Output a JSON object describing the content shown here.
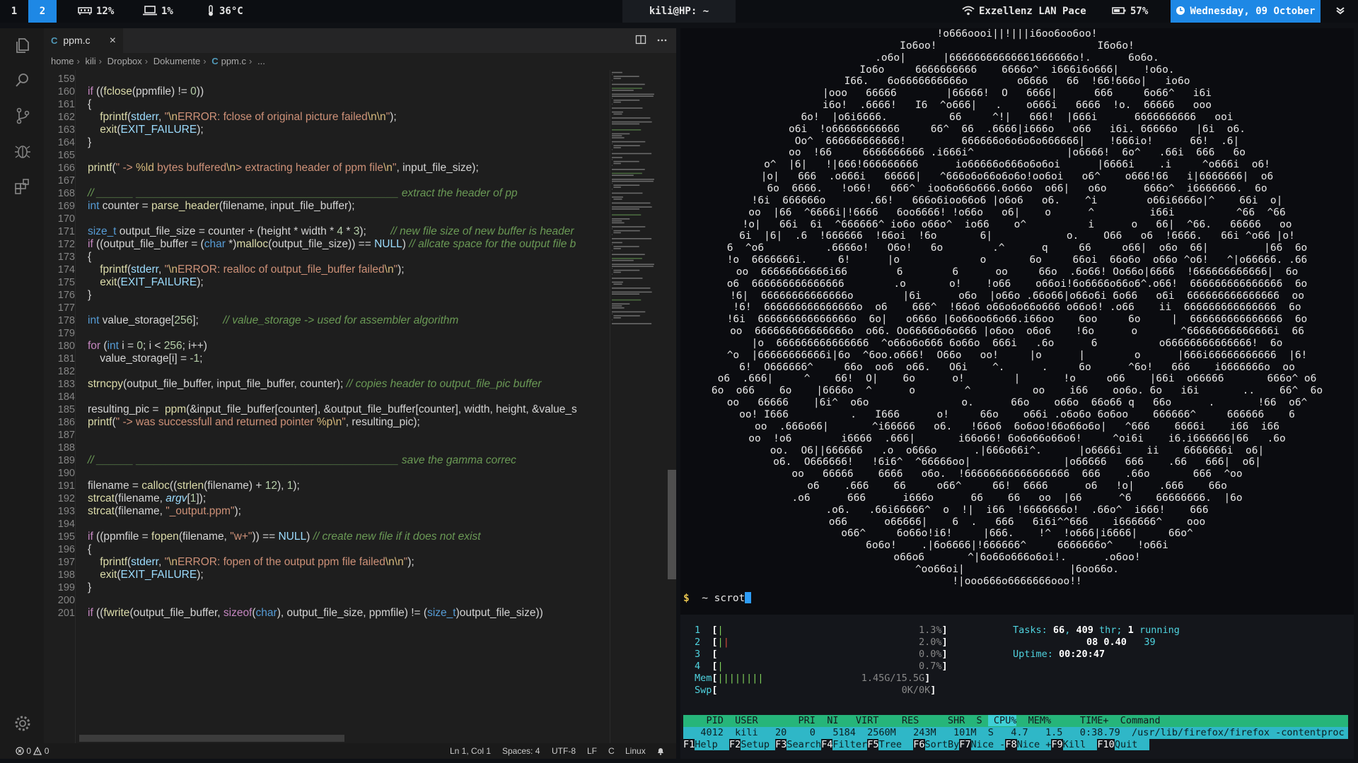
{
  "topbar": {
    "workspaces": [
      "1",
      "2"
    ],
    "ram": "12%",
    "cpu": "1%",
    "temp": "36°C",
    "window_title": "kili@HP: ~",
    "wifi": "Exzellenz LAN Pace",
    "battery": "57%",
    "date": "Wednesday, 09 October"
  },
  "editor": {
    "tab": {
      "icon": "C",
      "name": "ppm.c"
    },
    "breadcrumb": [
      "home",
      "kili",
      "Dropbox",
      "Dokumente",
      "ppm.c",
      "..."
    ],
    "breadcrumb_icon": "C",
    "lines": [
      {
        "n": "159",
        "t": ""
      },
      {
        "n": "160",
        "t": "if ((fclose(ppmfile) != 0))"
      },
      {
        "n": "161",
        "t": "{"
      },
      {
        "n": "162",
        "t": "    fprintf(stderr, \"\\nERROR: fclose of original picture failed\\n\\n\");"
      },
      {
        "n": "163",
        "t": "    exit(EXIT_FAILURE);"
      },
      {
        "n": "164",
        "t": "}"
      },
      {
        "n": "165",
        "t": ""
      },
      {
        "n": "166",
        "t": "printf(\" -> %ld bytes buffered\\n> extracting header of ppm file\\n\", input_file_size);"
      },
      {
        "n": "167",
        "t": ""
      },
      {
        "n": "168",
        "t": "// ______ ___________________________________________ extract the header of pp"
      },
      {
        "n": "169",
        "t": "int counter = parse_header(filename, input_file_buffer);"
      },
      {
        "n": "170",
        "t": ""
      },
      {
        "n": "171",
        "t": "size_t output_file_size = counter + (height * width * 4 * 3);        // new file size of new buffer is header"
      },
      {
        "n": "172",
        "t": "if ((output_file_buffer = (char *)malloc(output_file_size)) == NULL) // allcate space for the output file b"
      },
      {
        "n": "173",
        "t": "{"
      },
      {
        "n": "174",
        "t": "    fprintf(stderr, \"\\nERROR: realloc of output_file_buffer failed\\n\");"
      },
      {
        "n": "175",
        "t": "    exit(EXIT_FAILURE);"
      },
      {
        "n": "176",
        "t": "}"
      },
      {
        "n": "177",
        "t": ""
      },
      {
        "n": "178",
        "t": "int value_storage[256];        // value_storage -> used for assembler algorithm"
      },
      {
        "n": "179",
        "t": ""
      },
      {
        "n": "180",
        "t": "for (int i = 0; i < 256; i++)"
      },
      {
        "n": "181",
        "t": "    value_storage[i] = -1;"
      },
      {
        "n": "182",
        "t": ""
      },
      {
        "n": "183",
        "t": "strncpy(output_file_buffer, input_file_buffer, counter); // copies header to output_file_pic buffer"
      },
      {
        "n": "184",
        "t": ""
      },
      {
        "n": "185",
        "t": "resulting_pic =  ppm(&input_file_buffer[counter], &output_file_buffer[counter], width, height, &value_s"
      },
      {
        "n": "186",
        "t": "printf(\" -> was successfull and returned pointer %p\\n\", resulting_pic);"
      },
      {
        "n": "187",
        "t": ""
      },
      {
        "n": "188",
        "t": ""
      },
      {
        "n": "189",
        "t": "// ______ ___________________________________________ save the gamma correc"
      },
      {
        "n": "190",
        "t": ""
      },
      {
        "n": "191",
        "t": "filename = calloc((strlen(filename) + 12), 1);"
      },
      {
        "n": "192",
        "t": "strcat(filename, argv[1]);"
      },
      {
        "n": "193",
        "t": "strcat(filename, \"_output.ppm\");"
      },
      {
        "n": "194",
        "t": ""
      },
      {
        "n": "195",
        "t": "if ((ppmfile = fopen(filename, \"w+\")) == NULL) // create new file if it does not exist"
      },
      {
        "n": "196",
        "t": "{"
      },
      {
        "n": "197",
        "t": "    fprintf(stderr, \"\\nERROR: fopen of the output ppm file failed\\n\\n\");"
      },
      {
        "n": "198",
        "t": "    exit(EXIT_FAILURE);"
      },
      {
        "n": "199",
        "t": "}"
      },
      {
        "n": "200",
        "t": ""
      },
      {
        "n": "201",
        "t": "if ((fwrite(output_file_buffer, sizeof(char), output_file_size, ppmfile) != (size_t)output_file_size))"
      }
    ],
    "status": {
      "errors": "0",
      "warnings": "0",
      "position": "Ln 1, Col 1",
      "spaces": "Spaces: 4",
      "encoding": "UTF-8",
      "eol": "LF",
      "language": "C",
      "platform": "Linux"
    }
  },
  "terminal": {
    "ascii_art": "!o666oooi||!|||i6oo6oo6oo!\nIo6oo!                          I6o6o!\n.o6o|      |66666666666661666666o!.      6o6o.\nIo6o     6666666666    6666o^  i666i6o666|    !o6o.\nI66.   6o6666666666o        o6666   66  !66!666o|   io6o\n|ooo   66666        |66666!  O   6666|      666     6o66^   i6i\ni6o!  .6666!   I6  ^o666|   .    o666i   6666  !o.  66666   ooo\n6o!  |o6i6666.          66     ^!|   666!  |666i      6666666666   ooi\no6i  !o66666666666     66^  66  .6666|i666o   o66   i6i. 66666o   |6i  o6.\nOo^  666666666666!         666666o6o6o6o666666|    !666io!      66!  .6|\noo  !66     6666666666 .i666i^               |o6666!  6o^   .66i  666   6o\no^  |6|   !|666!666666666      io66666o666o6o6oi      |6666i    .i     ^o666i  o6!\n|o|   666  .o666i   66666|   ^666o6o66o6o6o!oo6oi   o6^    o666!66   i|6666666|  o6\n6o  6666.   !o66!   666^  ioo6o66o666.6o66o  o66|   o6o      666o^  i6666666.  6o\n!6i  666666o       .66!   666o6ioo66o6 |o6o6   o6.    ^i        o66i6666o|^    66i  o|\noo  |66  ^6666i|!6666   6oo6666! !o66o   o6|    o      ^         i66i          ^66  ^66\n!o|   66i  6i  ^666666^ io6o o66o^  io66    o^          i      o   66|  ^66.   66666   oo\n6i  |6|  .6  !666666  !66oi  !6o       6|            o.    O66   o6  !6666.   66i ^o66 |o!\n6  ^o6          .6666o!   O6o!   6o        .^      q     66     o66|  o6o  66|         |66  6o\n!o  6666666i.     6!      |o             o       6o     66oi  66o6o  o66o ^o6!   ^|o66666. .66\noo  66666666666i66        6        6      oo     66o  .6o66! Oo66o|6666  !666666666666|  6o\no6  666666666666666        .o       o!    !o66    o66oi!6o6666o66o6^.o66!  666666666666666  6o\n!6|  66666666666666o        |6i      o6o  |o66o .66o66|o66o6i 6o66   o6i  666666666666666  oo\n!6!  666666666666666o  o6    666^  !66o6 o66o6o66o666 o66o6! .o66    ii  666666666666666  6o\n!6i  666666666666666o  6o|   o666o |6o66oo66o66.i66oo    6oo     6o     |  666666666666666  6o\noo  666666666666666o  o66. Oo66666o6o666 |o6oo  o6o6    !6o      o       ^66666666666666i  66\n|o  666666666666666  ^o66o6o666 6o66o  666i   .6o      6          o66666666666666!  6o\n^o  |66666666666i|6o  ^6oo.o666!  O66o   oo!     |o      |        o      |666i66666666666  |6!\n6!  O666666^     66o  oo6  o66.   O6i    ^.      .     6o      ^6o!   666    i6666666o  oo\no6  .666|     ^    66!  O|    6o      o!        |       !o     o66    |66i  o66666       666o^ o6\n6o  o66    6o    |6666o  ^      o        ^          oo    i66    oo6o. 6o   i6i       ..    66^  6o\noo   66666    |6i^  o6o               o.      66o    o66o  66o66 q   66o      .       !66  o6^\noo! I666          .   I666      o!     66o    o66i .o6o6o 6o6oo    666666^     666666    6\noo  .666o66|       ^i66666   o6.   !66o6  6o6oo!66o66o6o|   ^666    6666i    i66  i66\noo  !o6        i6666  .666|       i66o66! 6o6o66o66o6!     ^oi6i    i6.i666666|66   .6o\noo.  O6||666666   .o  o666o      .|666o66i^.      |o6666i    ii    6666666i  o6|\no6.  O666666!   !6i6^  ^66666oo|               |o66666   666    .66   666|  o6|\noo   66666    6666   o6o.  !66666666666666666  666    .66o       666  ^oo\no6    .666    66     o66^     66!  6666      o6   !o|    .666    66o\n.o6      666      i666o      66    66   oo  |66      ^6    66666666.  |6o\n.o6.   .66i66666^  o  !|  i66  !6666666o!  .66o^  i666!    666\no66      o66666|    6  .   666   6i6i^^666    i666666^    ooo\no66^     6o66o!i6!     |666.    !^  !o666|i6666|     66o^\n6o6o!    .|6o6666|!666666^     6666666o^    !o66i\no66o6       ^|6o66o666o6oi!.      .o6oo!\n^oo66oi|                 |6oo66o.\n!|ooo666o6666666ooo!!",
    "prompt_symbol": "$",
    "prompt_path": "~",
    "command": "scrot"
  },
  "htop": {
    "cpus": [
      {
        "id": "1",
        "bar": "|",
        "pct": "1.3%"
      },
      {
        "id": "2",
        "bar": "||",
        "pct": "2.0%"
      },
      {
        "id": "3",
        "bar": "",
        "pct": "0.0%"
      },
      {
        "id": "4",
        "bar": "|",
        "pct": "0.7%"
      }
    ],
    "mem": {
      "label": "Mem",
      "bar": "||||||||",
      "value": "1.45G/15.5G"
    },
    "swp": {
      "label": "Swp",
      "bar": "",
      "value": "0K/0K"
    },
    "tasks": {
      "label": "Tasks:",
      "count": "66",
      "threads": "409",
      "thr_label": "thr;",
      "running": "1",
      "running_label": "running"
    },
    "load": {
      "a": "08",
      "b": "0.40",
      "c": "39"
    },
    "uptime": {
      "label": "Uptime:",
      "value": "00:20:47"
    },
    "columns": [
      "PID",
      "USER",
      "PRI",
      "NI",
      "VIRT",
      "RES",
      "SHR",
      "S",
      "CPU%",
      "MEM%",
      "TIME+",
      "Command"
    ],
    "process": {
      "pid": "4012",
      "user": "kili",
      "pri": "20",
      "ni": "0",
      "virt": "5184",
      "res": "2560M",
      "shr": "243M",
      "s": "101M",
      "state": "S",
      "cpu": "4.7",
      "mem": "1.5",
      "time": "0:38.79",
      "command": "/usr/lib/firefox/firefox -contentproc -"
    },
    "fkeys": [
      {
        "k": "F1",
        "l": "Help"
      },
      {
        "k": "F2",
        "l": "Setup"
      },
      {
        "k": "F3",
        "l": "Search"
      },
      {
        "k": "F4",
        "l": "Filter"
      },
      {
        "k": "F5",
        "l": "Tree"
      },
      {
        "k": "F6",
        "l": "SortBy"
      },
      {
        "k": "F7",
        "l": "Nice -"
      },
      {
        "k": "F8",
        "l": "Nice +"
      },
      {
        "k": "F9",
        "l": "Kill"
      },
      {
        "k": "F10",
        "l": "Quit"
      }
    ]
  }
}
